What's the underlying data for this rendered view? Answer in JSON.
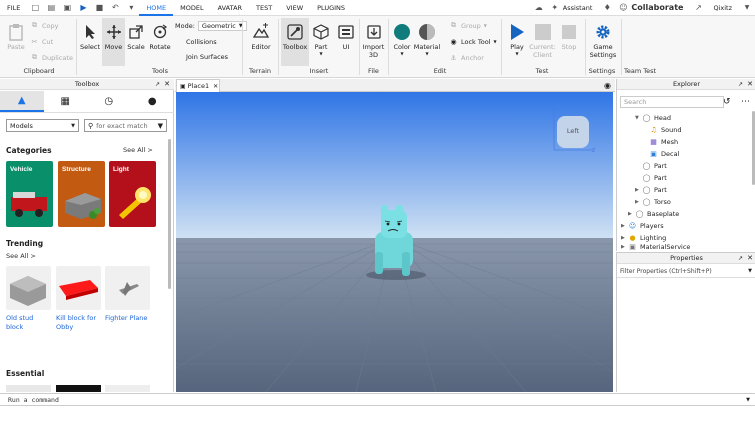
{
  "menubar": {
    "file": "FILE",
    "tabs": [
      "HOME",
      "MODEL",
      "AVATAR",
      "TEST",
      "VIEW",
      "PLUGINS"
    ],
    "active_tab": "HOME",
    "assistant": "Assistant",
    "collaborate": "Collaborate",
    "user": "Qixitz"
  },
  "ribbon": {
    "clipboard": {
      "paste": "Paste",
      "copy": "Copy",
      "cut": "Cut",
      "duplicate": "Duplicate",
      "label": "Clipboard"
    },
    "tools": {
      "select": "Select",
      "move": "Move",
      "scale": "Scale",
      "rotate": "Rotate",
      "mode_label": "Mode:",
      "mode_value": "Geometric",
      "collisions": "Collisions",
      "join_surfaces": "Join Surfaces",
      "label": "Tools"
    },
    "terrain": {
      "editor": "Editor",
      "label": "Terrain"
    },
    "insert": {
      "toolbox": "Toolbox",
      "part": "Part",
      "ui": "UI",
      "label": "Insert"
    },
    "file": {
      "import3d": "Import 3D",
      "label": "File"
    },
    "edit": {
      "color": "Color",
      "material": "Material",
      "group": "Group",
      "lock_tool": "Lock Tool",
      "anchor": "Anchor",
      "label": "Edit"
    },
    "test": {
      "play": "Play",
      "current_client": "Current: Client",
      "stop": "Stop",
      "label": "Test"
    },
    "settings": {
      "game_settings": "Game Settings",
      "label": "Settings"
    },
    "team_test": {
      "label": "Team Test"
    }
  },
  "toolbox": {
    "title": "Toolbox",
    "category_select": "Models",
    "search_placeholder": "for exact match",
    "categories_heading": "Categories",
    "see_all": "See All >",
    "categories": [
      {
        "label": "Vehicle",
        "color": "#0a8f6b"
      },
      {
        "label": "Structure",
        "color": "#c25a12"
      },
      {
        "label": "Light",
        "color": "#b3101c"
      }
    ],
    "trending_heading": "Trending",
    "trending_see_all": "See All >",
    "trending": [
      "Old stud block",
      "Kill block for Obby",
      "Fighter Plane"
    ],
    "essential_heading": "Essential"
  },
  "viewport": {
    "tab": "Place1",
    "view_cube": "Left"
  },
  "explorer": {
    "title": "Explorer",
    "search_placeholder": "Search",
    "items": [
      "Head",
      "Sound",
      "Mesh",
      "Decal",
      "Part",
      "Part",
      "Part",
      "Torso",
      "Baseplate",
      "Players",
      "Lighting",
      "MaterialService"
    ]
  },
  "properties": {
    "title": "Properties",
    "filter_placeholder": "Filter Properties (Ctrl+Shift+P)"
  },
  "command_bar": {
    "placeholder": "Run a command"
  },
  "colors": {
    "accent": "#1a73e8",
    "play": "#1565c0",
    "color_swatch": "#0f7b7b",
    "sky_top": "#2f75e6",
    "sky_bottom": "#cfe1f3",
    "ground": "#5c6c84"
  }
}
